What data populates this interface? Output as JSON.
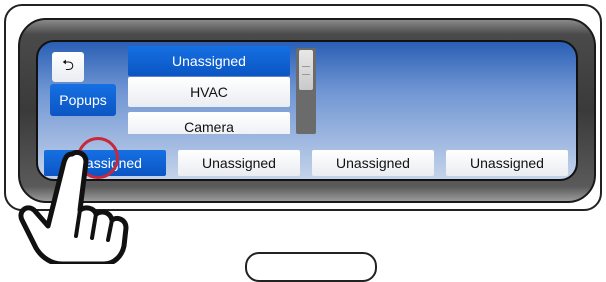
{
  "screen": {
    "back_icon": "back-arrow-icon",
    "back_glyph": "⮌",
    "popups_label": "Popups",
    "list_items": [
      "Unassigned",
      "HVAC",
      "Camera"
    ],
    "tabs": [
      "Unassigned",
      "Unassigned",
      "Unassigned",
      "Unassigned"
    ],
    "active_tab_index": 0,
    "selected_list_index": 0
  },
  "overlay": {
    "hand_icon": "pointing-hand-icon",
    "tap_indicator_color": "#c9273a"
  },
  "colors": {
    "accent_blue": "#0b55c4",
    "screen_top": "#2a5fb5",
    "screen_bottom": "#c4d3ea",
    "bezel": "#3a3a3a"
  }
}
